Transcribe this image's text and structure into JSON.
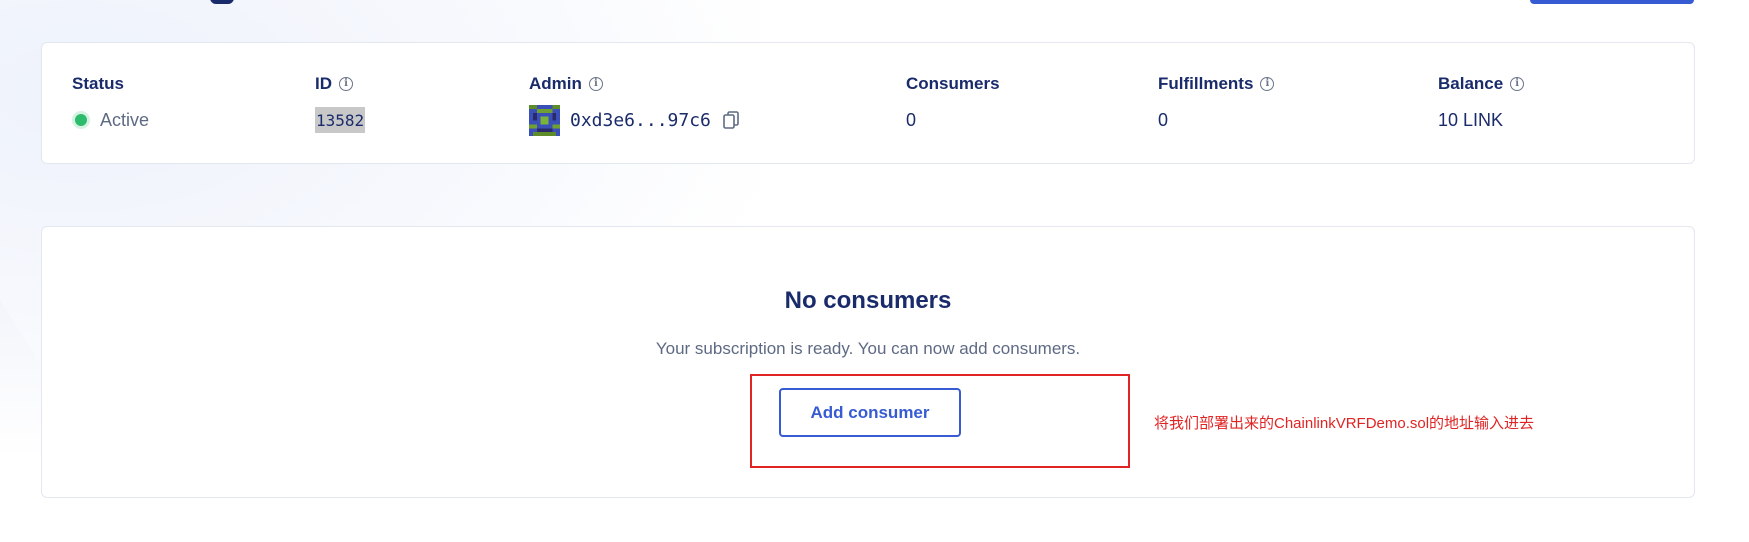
{
  "details": {
    "status": {
      "label": "Status",
      "value": "Active"
    },
    "id": {
      "label": "ID",
      "value": "13582"
    },
    "admin": {
      "label": "Admin",
      "value": "0xd3e6...97c6"
    },
    "consumers": {
      "label": "Consumers",
      "value": "0"
    },
    "fulfillments": {
      "label": "Fulfillments",
      "value": "0"
    },
    "balance": {
      "label": "Balance",
      "value": "10 LINK"
    }
  },
  "empty_state": {
    "title": "No consumers",
    "subtitle": "Your subscription is ready. You can now add consumers.",
    "button_label": "Add consumer"
  },
  "annotation": {
    "text": "将我们部署出来的ChainlinkVRFDemo.sol的地址输入进去",
    "color": "#e02424"
  },
  "colors": {
    "accent": "#375bd2",
    "status_active": "#2dbb6e",
    "heading": "#1a2b6b"
  },
  "icons": {
    "info": "info-icon",
    "copy": "copy-icon",
    "avatar": "identicon-avatar"
  }
}
